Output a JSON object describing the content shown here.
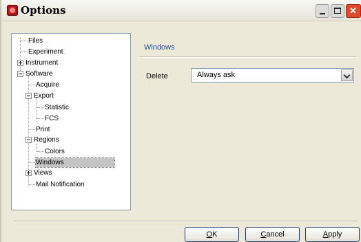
{
  "window": {
    "title": "Options"
  },
  "tree": {
    "items": [
      {
        "label": "Files"
      },
      {
        "label": "Experiment"
      },
      {
        "label": "Instrument"
      },
      {
        "label": "Software"
      },
      {
        "label": "Acquire"
      },
      {
        "label": "Export"
      },
      {
        "label": "Statistic"
      },
      {
        "label": "FCS"
      },
      {
        "label": "Print"
      },
      {
        "label": "Regions"
      },
      {
        "label": "Colors"
      },
      {
        "label": "Windows"
      },
      {
        "label": "Views"
      },
      {
        "label": "Mail Notification"
      }
    ],
    "selected": "Windows"
  },
  "content": {
    "section_title": "Windows",
    "delete_label": "Delete",
    "delete_value": "Always ask"
  },
  "buttons": {
    "ok": {
      "mnemonic": "O",
      "rest": "K"
    },
    "cancel": {
      "mnemonic": "C",
      "rest": "ancel"
    },
    "apply": {
      "mnemonic": "A",
      "rest": "pply"
    }
  },
  "icons": {
    "app": "app-logo-icon",
    "minimize": "minimize-icon",
    "maximize": "maximize-icon",
    "close": "close-icon",
    "expand": "plus-expander-icon",
    "collapse": "minus-expander-icon",
    "dropdown": "chevron-down-icon"
  },
  "colors": {
    "section_title": "#1f4f9c",
    "selection": "#c4c4c4",
    "close_button": "#e04a2c"
  }
}
